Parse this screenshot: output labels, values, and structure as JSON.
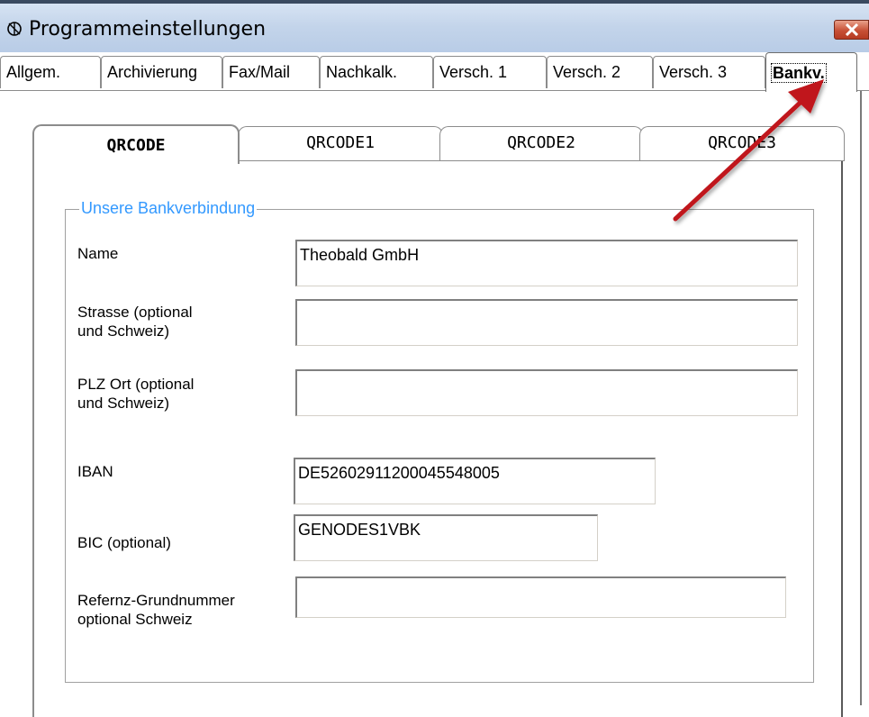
{
  "window": {
    "title": "Programmeinstellungen"
  },
  "outer_tabs": [
    {
      "label": "Allgem."
    },
    {
      "label": "Archivierung"
    },
    {
      "label": "Fax/Mail"
    },
    {
      "label": "Nachkalk."
    },
    {
      "label": "Versch. 1"
    },
    {
      "label": "Versch. 2"
    },
    {
      "label": "Versch. 3"
    },
    {
      "label": "Bankv."
    }
  ],
  "inner_tabs": [
    {
      "label": "QRCODE"
    },
    {
      "label": "QRCODE1"
    },
    {
      "label": "QRCODE2"
    },
    {
      "label": "QRCODE3"
    }
  ],
  "group": {
    "legend": "Unsere Bankverbindung",
    "fields": {
      "name": {
        "label": "Name",
        "value": "Theobald GmbH"
      },
      "strasse": {
        "label": "Strasse (optional\nund Schweiz)",
        "value": ""
      },
      "plz_ort": {
        "label": "PLZ Ort (optional\nund Schweiz)",
        "value": ""
      },
      "iban": {
        "label": "IBAN",
        "value": "DE52602911200045548005"
      },
      "bic": {
        "label": "BIC (optional)",
        "value": "GENODES1VBK"
      },
      "referenz": {
        "label": "Refernz-Grundnummer\noptional Schweiz",
        "value": ""
      }
    }
  },
  "colors": {
    "legend": "#3399ff",
    "arrow": "#c0141a",
    "close": "#c75036"
  },
  "icons": {
    "app": "settings-icon",
    "close": "close-icon",
    "annotation": "red-arrow-icon"
  }
}
